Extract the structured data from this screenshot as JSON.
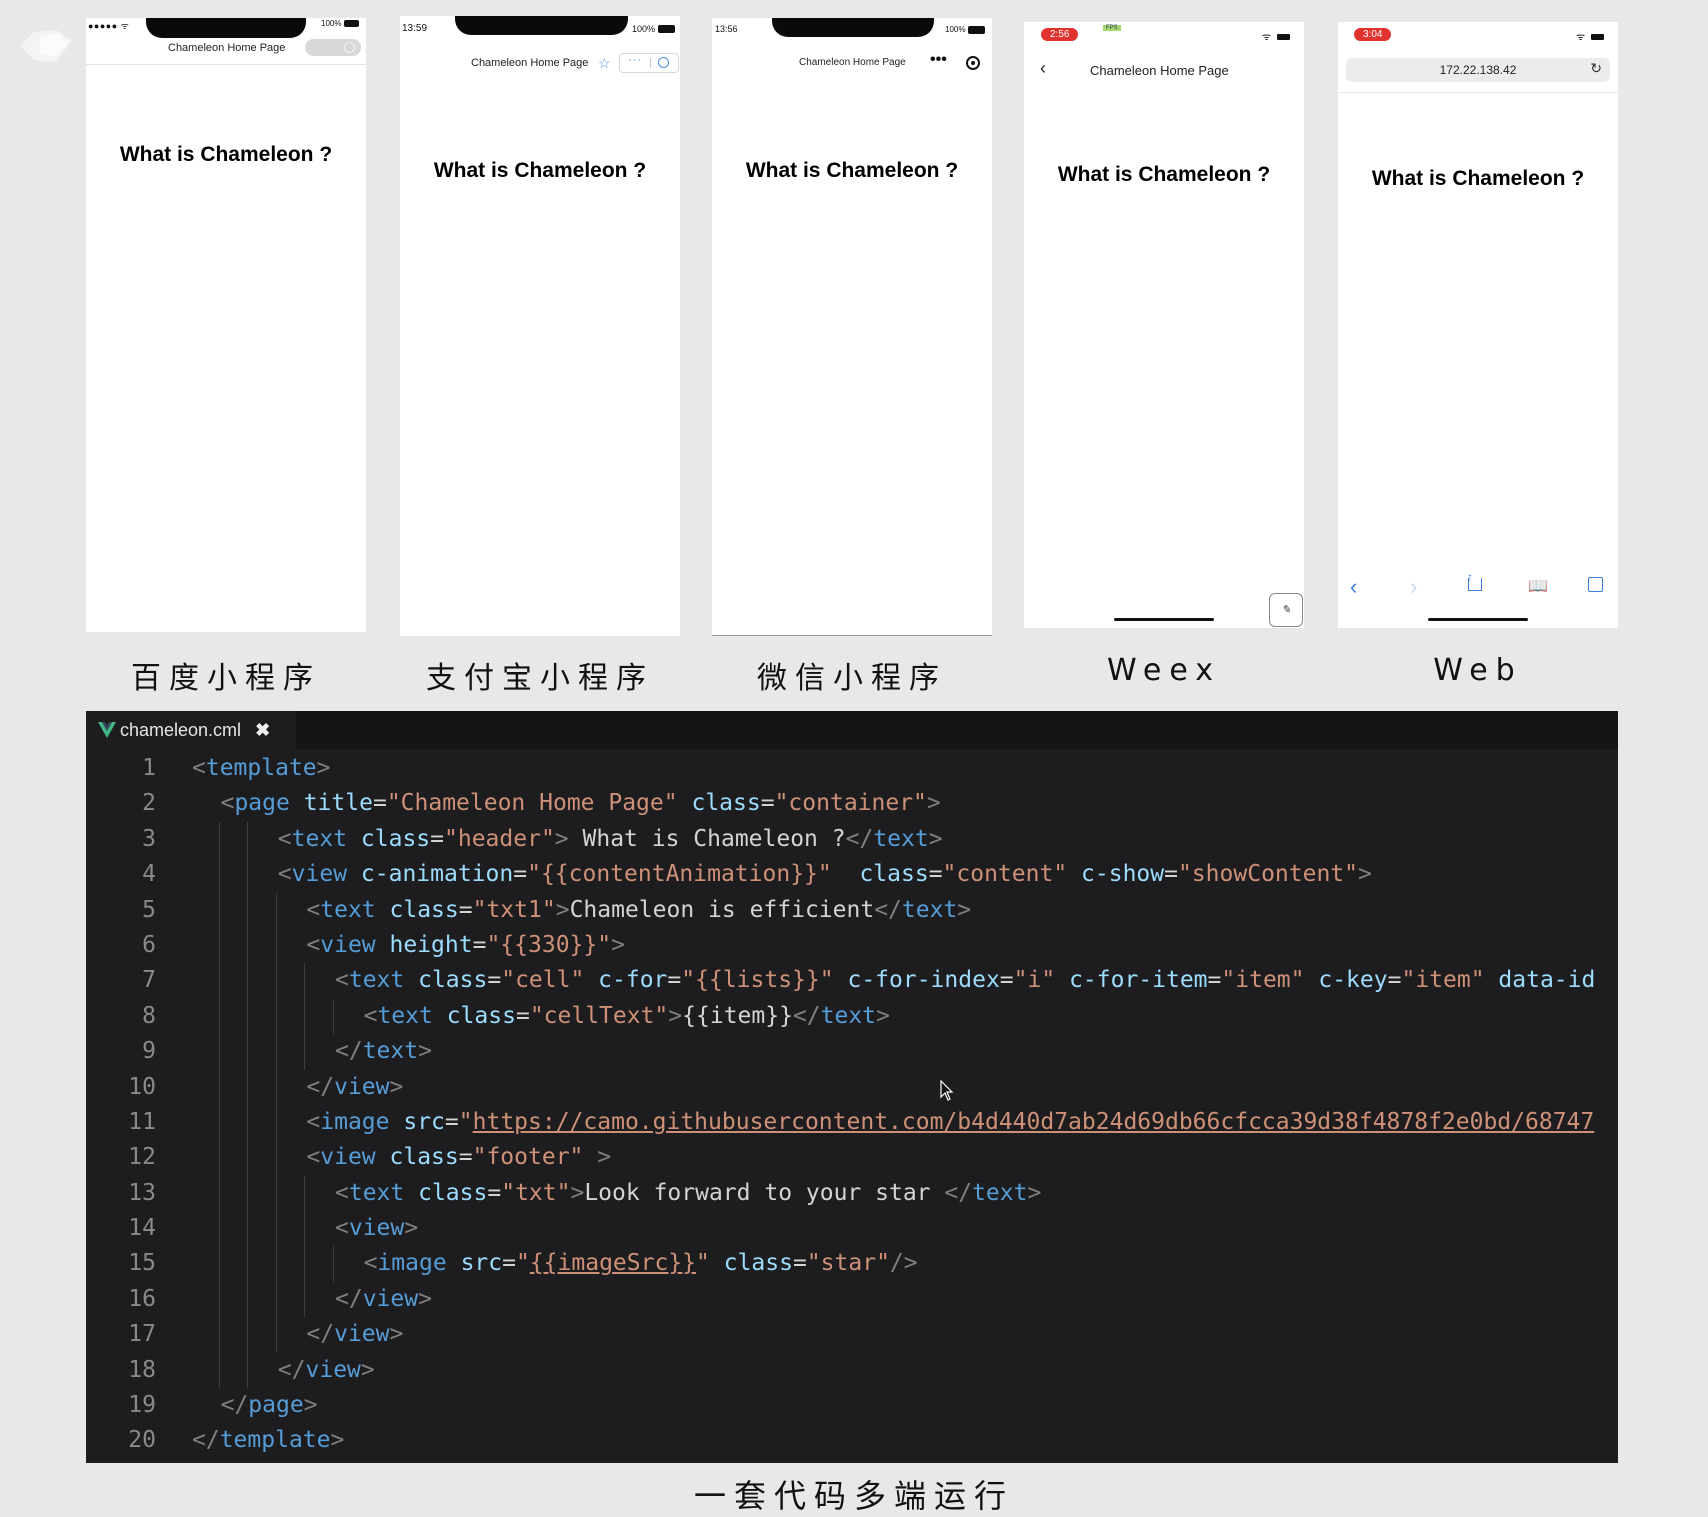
{
  "screens": [
    {
      "time": "",
      "dots": "●●●●● ᯤ",
      "battery": "100%",
      "title": "Chameleon Home Page",
      "heading": "What is Chameleon ?",
      "caption": "百度小程序"
    },
    {
      "time": "13:59",
      "battery": "100%",
      "title": "Chameleon Home Page",
      "heading": "What is Chameleon ?",
      "caption": "支付宝小程序"
    },
    {
      "time": "13:56",
      "battery": "100%",
      "title": "Chameleon Home Page",
      "heading": "What is Chameleon ?",
      "caption": "微信小程序"
    },
    {
      "time": "2:56",
      "fps": "FPS",
      "title": "Chameleon Home Page",
      "heading": "What is Chameleon ?",
      "caption": "Weex"
    },
    {
      "time": "3:04",
      "url": "172.22.138.42",
      "heading": "What is Chameleon ?",
      "caption": "Web"
    }
  ],
  "editor": {
    "tab_label": "chameleon.cml",
    "close_glyph": "✖",
    "lines": [
      {
        "n": "1",
        "indent": 0,
        "tokens": [
          [
            "p",
            "<"
          ],
          [
            "t",
            "template"
          ],
          [
            "p",
            ">"
          ]
        ]
      },
      {
        "n": "2",
        "indent": 1,
        "tokens": [
          [
            "p",
            "<"
          ],
          [
            "t",
            "page"
          ],
          [
            "x",
            " "
          ],
          [
            "a",
            "title"
          ],
          [
            "x",
            "="
          ],
          [
            "s",
            "\"Chameleon Home Page\""
          ],
          [
            "x",
            " "
          ],
          [
            "a",
            "class"
          ],
          [
            "x",
            "="
          ],
          [
            "s",
            "\"container\""
          ],
          [
            "p",
            ">"
          ]
        ]
      },
      {
        "n": "3",
        "indent": 3,
        "tokens": [
          [
            "p",
            "<"
          ],
          [
            "t",
            "text"
          ],
          [
            "x",
            " "
          ],
          [
            "a",
            "class"
          ],
          [
            "x",
            "="
          ],
          [
            "s",
            "\"header\""
          ],
          [
            "p",
            ">"
          ],
          [
            "x",
            " What is Chameleon ?"
          ],
          [
            "p",
            "</"
          ],
          [
            "t",
            "text"
          ],
          [
            "p",
            ">"
          ]
        ]
      },
      {
        "n": "4",
        "indent": 3,
        "tokens": [
          [
            "p",
            "<"
          ],
          [
            "t",
            "view"
          ],
          [
            "x",
            " "
          ],
          [
            "a",
            "c-animation"
          ],
          [
            "x",
            "="
          ],
          [
            "s",
            "\"{{contentAnimation}}\""
          ],
          [
            "x",
            "  "
          ],
          [
            "a",
            "class"
          ],
          [
            "x",
            "="
          ],
          [
            "s",
            "\"content\""
          ],
          [
            "x",
            " "
          ],
          [
            "a",
            "c-show"
          ],
          [
            "x",
            "="
          ],
          [
            "s",
            "\"showContent\""
          ],
          [
            "p",
            ">"
          ]
        ]
      },
      {
        "n": "5",
        "indent": 4,
        "tokens": [
          [
            "p",
            "<"
          ],
          [
            "t",
            "text"
          ],
          [
            "x",
            " "
          ],
          [
            "a",
            "class"
          ],
          [
            "x",
            "="
          ],
          [
            "s",
            "\"txt1\""
          ],
          [
            "p",
            ">"
          ],
          [
            "x",
            "Chameleon is efficient"
          ],
          [
            "p",
            "</"
          ],
          [
            "t",
            "text"
          ],
          [
            "p",
            ">"
          ]
        ]
      },
      {
        "n": "6",
        "indent": 4,
        "tokens": [
          [
            "p",
            "<"
          ],
          [
            "t",
            "view"
          ],
          [
            "x",
            " "
          ],
          [
            "a",
            "height"
          ],
          [
            "x",
            "="
          ],
          [
            "s",
            "\"{{330}}\""
          ],
          [
            "p",
            ">"
          ]
        ]
      },
      {
        "n": "7",
        "indent": 5,
        "tokens": [
          [
            "p",
            "<"
          ],
          [
            "t",
            "text"
          ],
          [
            "x",
            " "
          ],
          [
            "a",
            "class"
          ],
          [
            "x",
            "="
          ],
          [
            "s",
            "\"cell\""
          ],
          [
            "x",
            " "
          ],
          [
            "a",
            "c-for"
          ],
          [
            "x",
            "="
          ],
          [
            "s",
            "\"{{lists}}\""
          ],
          [
            "x",
            " "
          ],
          [
            "a",
            "c-for-index"
          ],
          [
            "x",
            "="
          ],
          [
            "s",
            "\"i\""
          ],
          [
            "x",
            " "
          ],
          [
            "a",
            "c-for-item"
          ],
          [
            "x",
            "="
          ],
          [
            "s",
            "\"item\""
          ],
          [
            "x",
            " "
          ],
          [
            "a",
            "c-key"
          ],
          [
            "x",
            "="
          ],
          [
            "s",
            "\"item\""
          ],
          [
            "x",
            " "
          ],
          [
            "a",
            "data-id"
          ]
        ]
      },
      {
        "n": "8",
        "indent": 6,
        "tokens": [
          [
            "p",
            "<"
          ],
          [
            "t",
            "text"
          ],
          [
            "x",
            " "
          ],
          [
            "a",
            "class"
          ],
          [
            "x",
            "="
          ],
          [
            "s",
            "\"cellText\""
          ],
          [
            "p",
            ">"
          ],
          [
            "x",
            "{{item}}"
          ],
          [
            "p",
            "</"
          ],
          [
            "t",
            "text"
          ],
          [
            "p",
            ">"
          ]
        ]
      },
      {
        "n": "9",
        "indent": 5,
        "tokens": [
          [
            "p",
            "</"
          ],
          [
            "t",
            "text"
          ],
          [
            "p",
            ">"
          ]
        ]
      },
      {
        "n": "10",
        "indent": 4,
        "tokens": [
          [
            "p",
            "</"
          ],
          [
            "t",
            "view"
          ],
          [
            "p",
            ">"
          ]
        ]
      },
      {
        "n": "11",
        "indent": 4,
        "tokens": [
          [
            "p",
            "<"
          ],
          [
            "t",
            "image"
          ],
          [
            "x",
            " "
          ],
          [
            "a",
            "src"
          ],
          [
            "x",
            "="
          ],
          [
            "s",
            "\""
          ],
          [
            "u",
            "https://camo.githubusercontent.com/b4d440d7ab24d69db66cfcca39d38f4878f2e0bd/68747"
          ]
        ]
      },
      {
        "n": "12",
        "indent": 4,
        "tokens": [
          [
            "p",
            "<"
          ],
          [
            "t",
            "view"
          ],
          [
            "x",
            " "
          ],
          [
            "a",
            "class"
          ],
          [
            "x",
            "="
          ],
          [
            "s",
            "\"footer\""
          ],
          [
            "x",
            " "
          ],
          [
            "p",
            ">"
          ]
        ]
      },
      {
        "n": "13",
        "indent": 5,
        "tokens": [
          [
            "p",
            "<"
          ],
          [
            "t",
            "text"
          ],
          [
            "x",
            " "
          ],
          [
            "a",
            "class"
          ],
          [
            "x",
            "="
          ],
          [
            "s",
            "\"txt\""
          ],
          [
            "p",
            ">"
          ],
          [
            "x",
            "Look forward to your star "
          ],
          [
            "p",
            "</"
          ],
          [
            "t",
            "text"
          ],
          [
            "p",
            ">"
          ]
        ]
      },
      {
        "n": "14",
        "indent": 5,
        "tokens": [
          [
            "p",
            "<"
          ],
          [
            "t",
            "view"
          ],
          [
            "p",
            ">"
          ]
        ]
      },
      {
        "n": "15",
        "indent": 6,
        "tokens": [
          [
            "p",
            "<"
          ],
          [
            "t",
            "image"
          ],
          [
            "x",
            " "
          ],
          [
            "a",
            "src"
          ],
          [
            "x",
            "="
          ],
          [
            "s",
            "\""
          ],
          [
            "u",
            "{{imageSrc}}"
          ],
          [
            "s",
            "\""
          ],
          [
            "x",
            " "
          ],
          [
            "a",
            "class"
          ],
          [
            "x",
            "="
          ],
          [
            "s",
            "\"star\""
          ],
          [
            "p",
            "/>"
          ]
        ]
      },
      {
        "n": "16",
        "indent": 5,
        "tokens": [
          [
            "p",
            "</"
          ],
          [
            "t",
            "view"
          ],
          [
            "p",
            ">"
          ]
        ]
      },
      {
        "n": "17",
        "indent": 4,
        "tokens": [
          [
            "p",
            "</"
          ],
          [
            "t",
            "view"
          ],
          [
            "p",
            ">"
          ]
        ]
      },
      {
        "n": "18",
        "indent": 3,
        "tokens": [
          [
            "p",
            "</"
          ],
          [
            "t",
            "view"
          ],
          [
            "p",
            ">"
          ]
        ]
      },
      {
        "n": "19",
        "indent": 1,
        "tokens": [
          [
            "p",
            "</"
          ],
          [
            "t",
            "page"
          ],
          [
            "p",
            ">"
          ]
        ]
      },
      {
        "n": "20",
        "indent": 0,
        "tokens": [
          [
            "p",
            "</"
          ],
          [
            "t",
            "template"
          ],
          [
            "p",
            ">"
          ]
        ]
      }
    ]
  },
  "bottom_caption": "一套代码多端运行"
}
